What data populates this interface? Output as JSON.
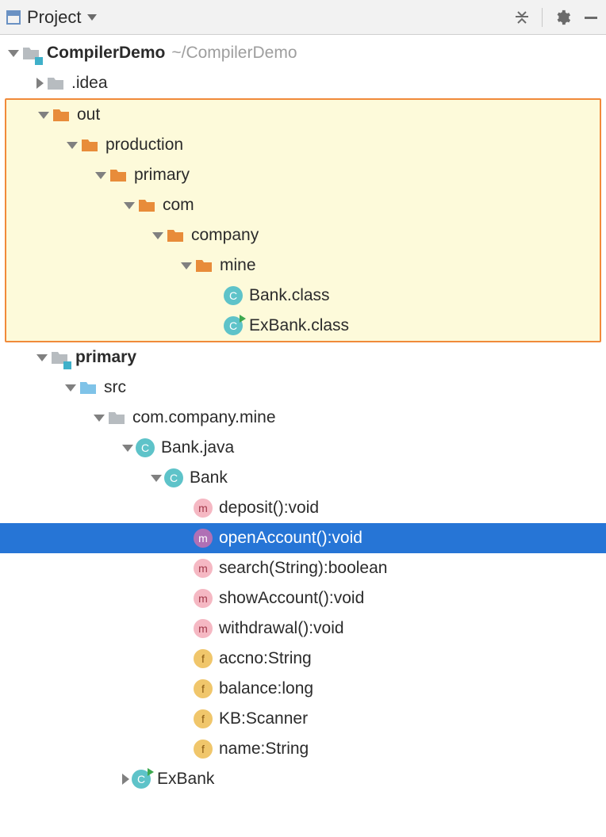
{
  "toolbar": {
    "title": "Project"
  },
  "tree": {
    "root": {
      "name": "CompilerDemo",
      "path": "~/CompilerDemo"
    },
    "idea": ".idea",
    "out": {
      "label": "out",
      "production": "production",
      "primary": "primary",
      "com": "com",
      "company": "company",
      "mine": "mine",
      "bankClass": "Bank.class",
      "exBankClass": "ExBank.class"
    },
    "module": {
      "primary": "primary",
      "src": "src",
      "pkg": "com.company.mine",
      "bankJava": "Bank.java",
      "bankClass": "Bank",
      "members": {
        "deposit": "deposit():void",
        "openAccount": "openAccount():void",
        "search": "search(String):boolean",
        "showAccount": "showAccount():void",
        "withdrawal": "withdrawal():void",
        "accno": "accno:String",
        "balance": "balance:long",
        "kb": "KB:Scanner",
        "name": "name:String"
      },
      "exBank": "ExBank"
    }
  }
}
